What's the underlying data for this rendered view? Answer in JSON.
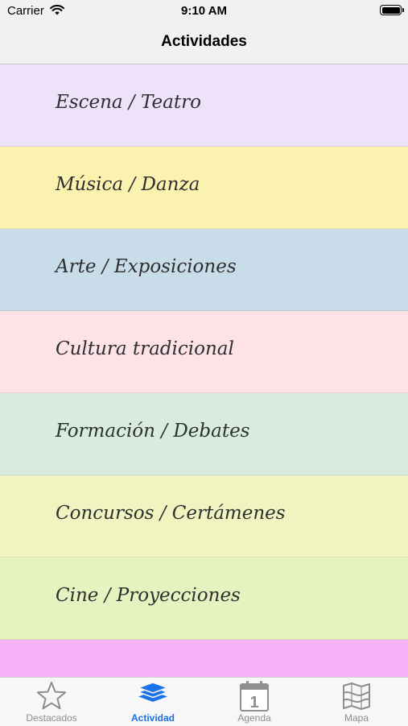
{
  "status_bar": {
    "carrier": "Carrier",
    "time": "9:10 AM"
  },
  "nav": {
    "title": "Actividades"
  },
  "categories": [
    {
      "label": "Escena / Teatro",
      "color": "#eee1fa"
    },
    {
      "label": "Música / Danza",
      "color": "#fcf2b0"
    },
    {
      "label": "Arte / Exposiciones",
      "color": "#c8dce9"
    },
    {
      "label": "Cultura tradicional",
      "color": "#fde2e8"
    },
    {
      "label": "Formación / Debates",
      "color": "#d7ecdf"
    },
    {
      "label": "Concursos / Certámenes",
      "color": "#eff4c0"
    },
    {
      "label": "Cine / Proyecciones",
      "color": "#e6f2c0"
    },
    {
      "label": "",
      "color": "#f6b1f7"
    }
  ],
  "tabs": [
    {
      "label": "Destacados",
      "icon": "star-icon",
      "active": false
    },
    {
      "label": "Actividad",
      "icon": "layers-icon",
      "active": true
    },
    {
      "label": "Agenda",
      "icon": "calendar-icon",
      "active": false
    },
    {
      "label": "Mapa",
      "icon": "map-icon",
      "active": false
    }
  ],
  "calendar_day": "1",
  "colors": {
    "active_tab": "#1a73e8",
    "inactive_tab": "#8e8e8e"
  }
}
